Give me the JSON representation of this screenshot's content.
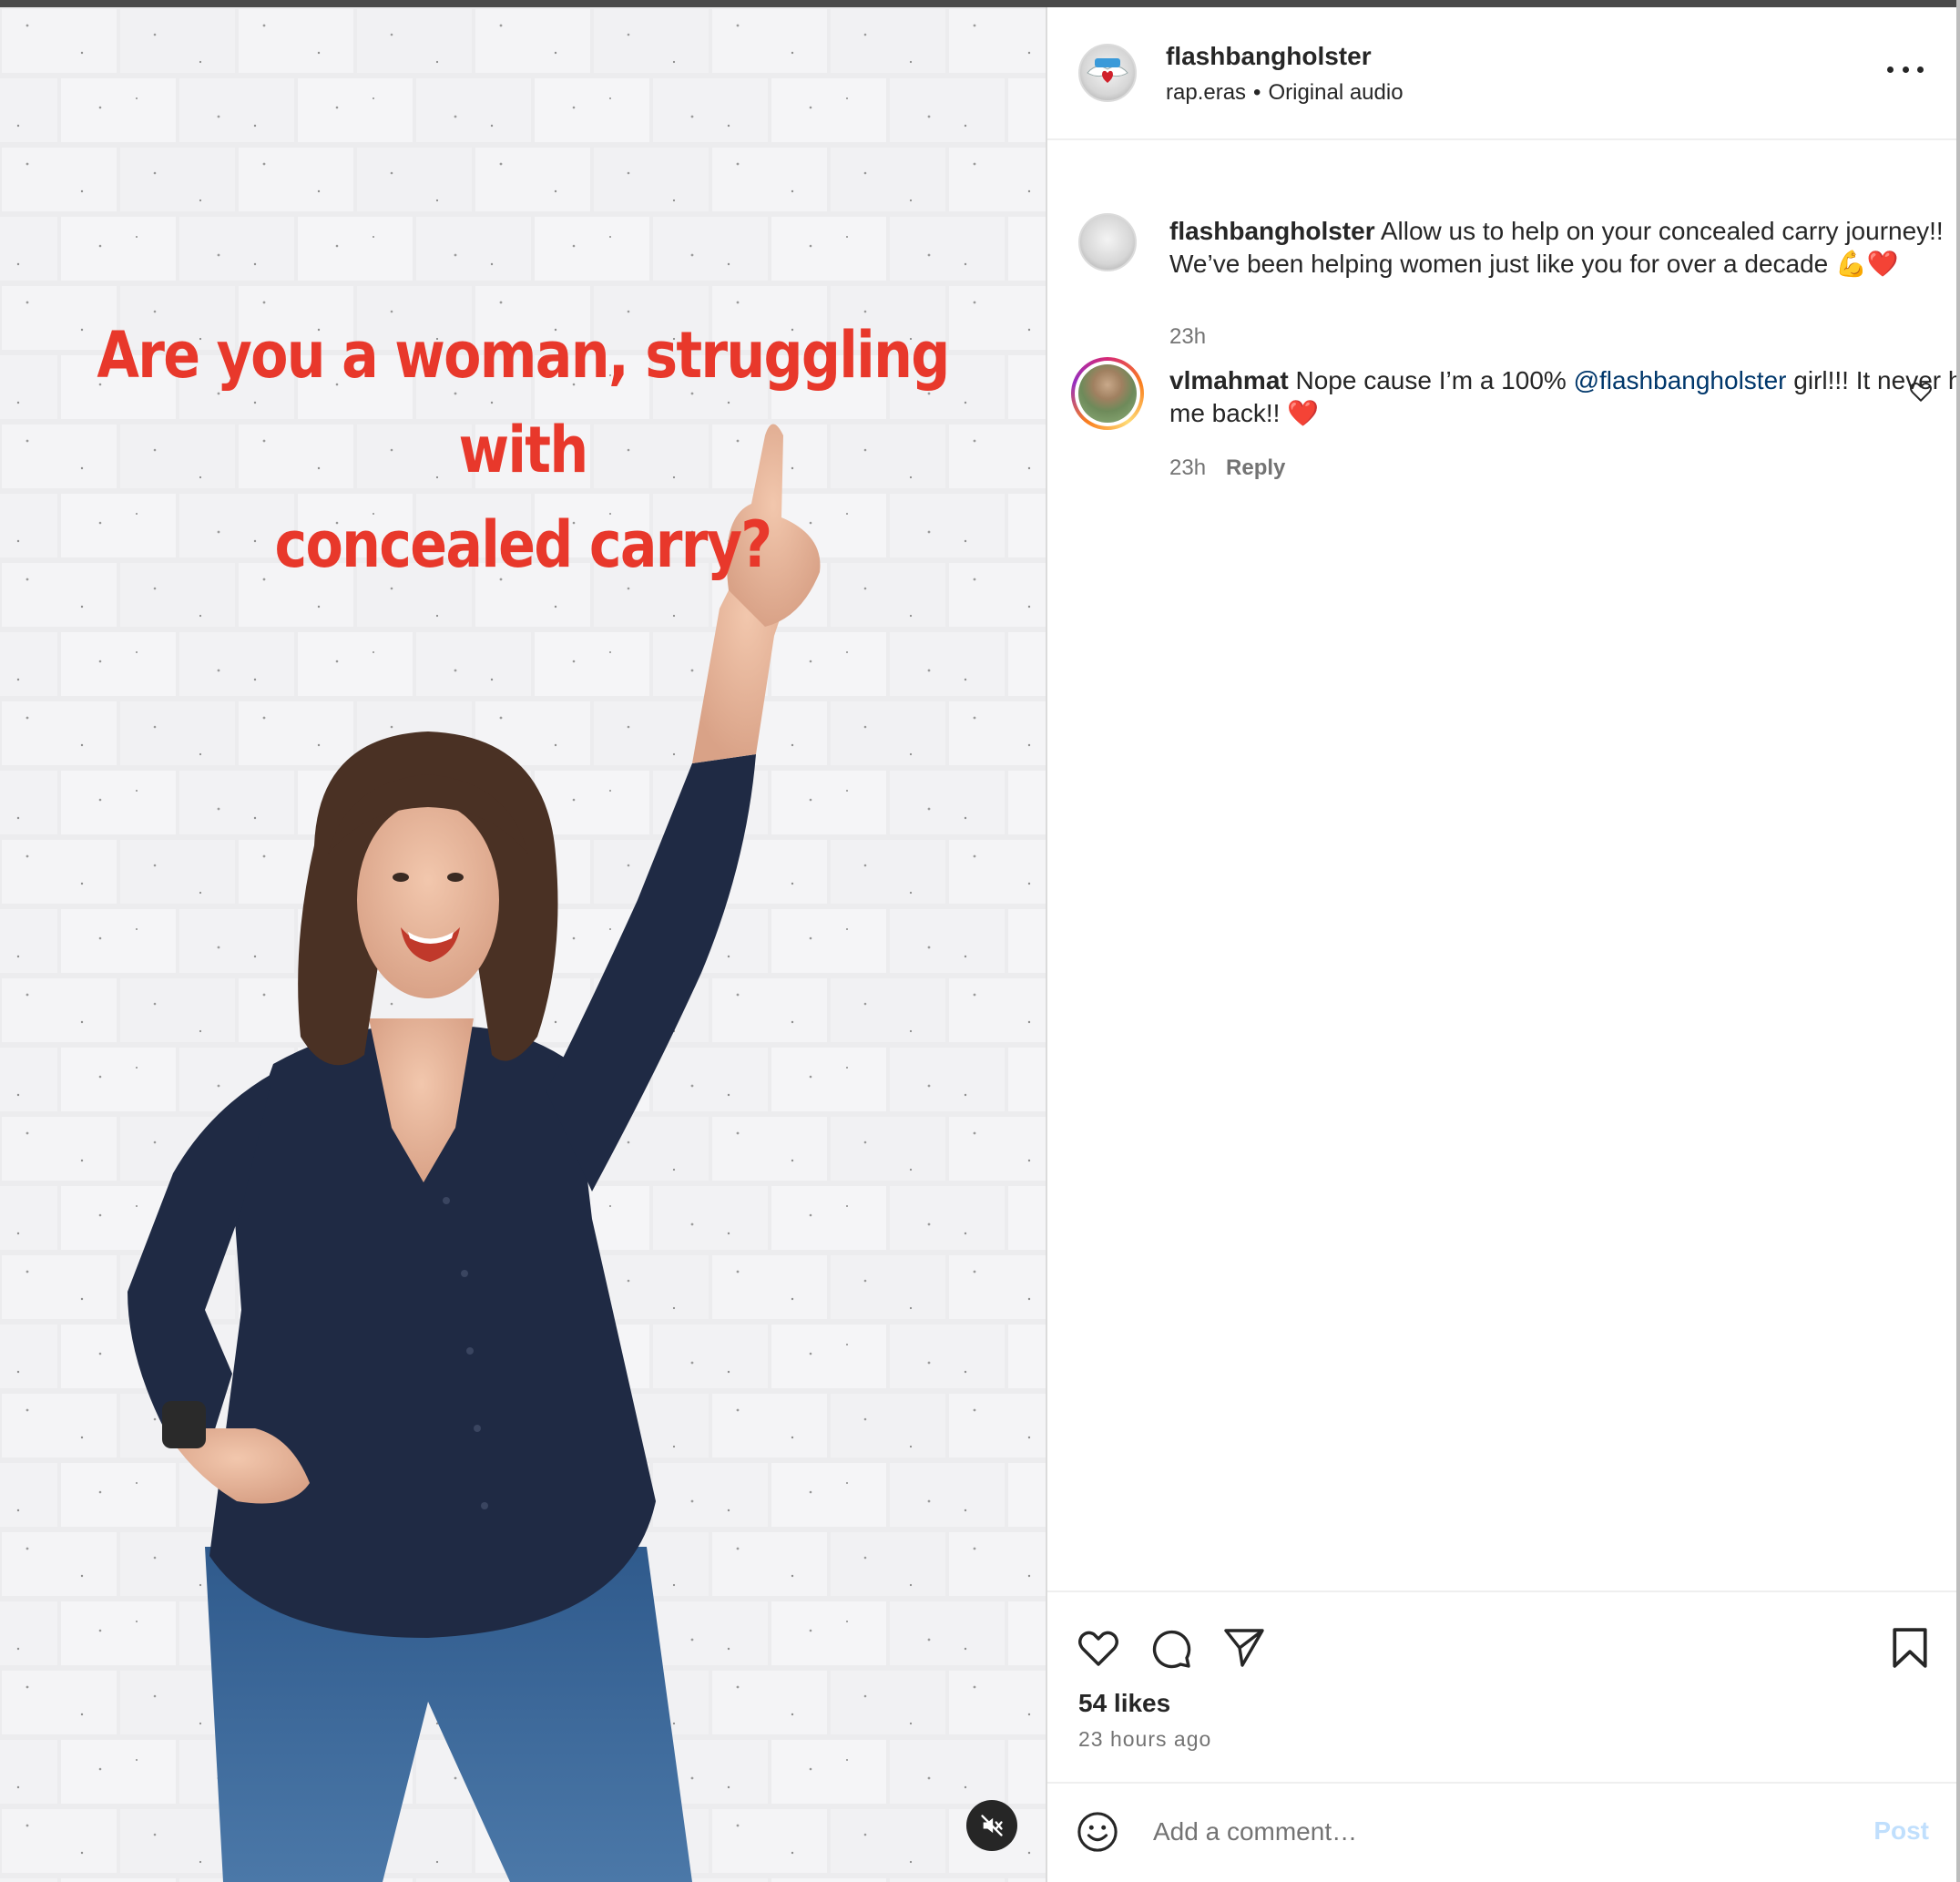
{
  "video": {
    "overlay_line1": "Are you a woman, struggling with",
    "overlay_line2": "concealed carry?",
    "mute_icon": "speaker-muted-icon"
  },
  "post": {
    "author": "flashbangholster",
    "audio_artist": "rap.eras",
    "separator": "•",
    "audio_label": "Original audio",
    "more_icon": "more-horizontal-icon"
  },
  "comments": [
    {
      "username": "flashbangholster",
      "text": "Allow us to help on your concealed carry journey!! We’ve been helping women just like you for over a decade",
      "emoji": "💪❤️",
      "time": "23h"
    },
    {
      "username": "vlmahmat",
      "text_before": "Nope cause I’m a 100%",
      "mention": "@flashbangholster",
      "text_after": "girl!!! It never holds me back!!",
      "emoji": "❤️",
      "time": "23h",
      "reply_label": "Reply"
    }
  ],
  "actions": {
    "like_icon": "heart-icon",
    "comment_icon": "comment-icon",
    "share_icon": "send-icon",
    "save_icon": "bookmark-icon"
  },
  "stats": {
    "likes": "54 likes",
    "time_ago": "23 hours ago"
  },
  "add_comment": {
    "emoji_icon": "emoji-smile-icon",
    "placeholder": "Add a comment…",
    "post_label": "Post",
    "post_color": "#c0dffd"
  },
  "colors": {
    "overlay_text": "#e8382b",
    "mention": "#00376b",
    "muted_text": "#737373"
  }
}
